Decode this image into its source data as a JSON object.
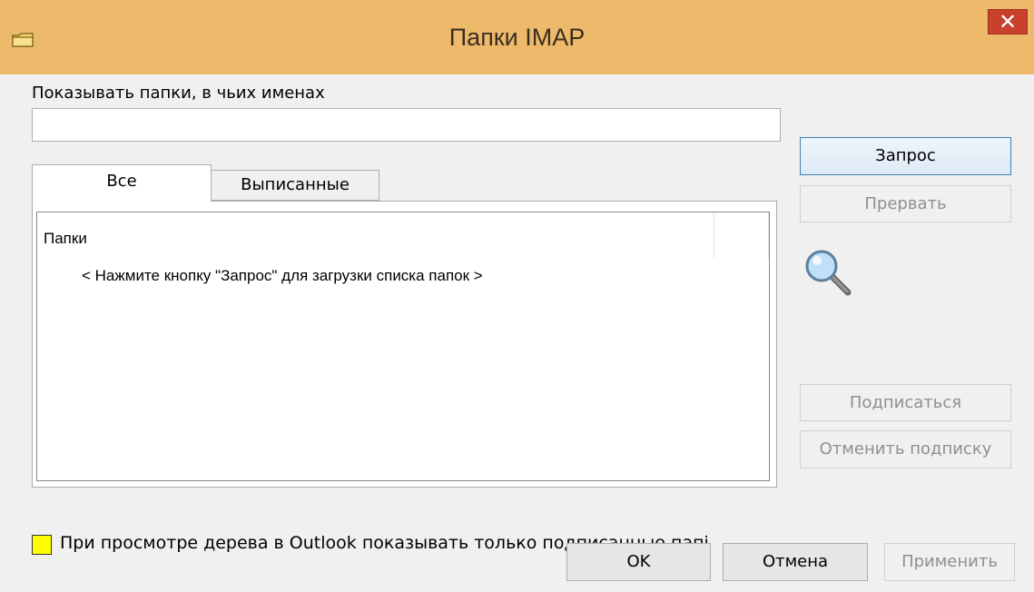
{
  "window": {
    "title": "Папки IMAP",
    "close_glyph": "✕"
  },
  "filter": {
    "label": "Показывать папки, в чьих именах",
    "value": ""
  },
  "tabs": [
    {
      "label": "Все",
      "active": true
    },
    {
      "label": "Выписанные",
      "active": false
    }
  ],
  "folder_list": {
    "column_header": "Папки",
    "placeholder": "< Нажмите кнопку \"Запрос\" для загрузки списка папок >"
  },
  "side_buttons": {
    "query": "Запрос",
    "abort": "Прервать",
    "subscribe": "Подписаться",
    "unsubscribe": "Отменить подписку"
  },
  "option": {
    "checkbox_label": "При просмотре дерева в Outlook показывать только подписанные папі",
    "checked": false
  },
  "footer_buttons": {
    "ok": "OK",
    "cancel": "Отмена",
    "apply": "Применить"
  },
  "icons": {
    "window_icon": "folder-icon",
    "search_icon": "magnifier-icon"
  },
  "colors": {
    "titlebar": "#edb96b",
    "close_button": "#c9402c",
    "checkbox_highlight": "#ffff00"
  }
}
